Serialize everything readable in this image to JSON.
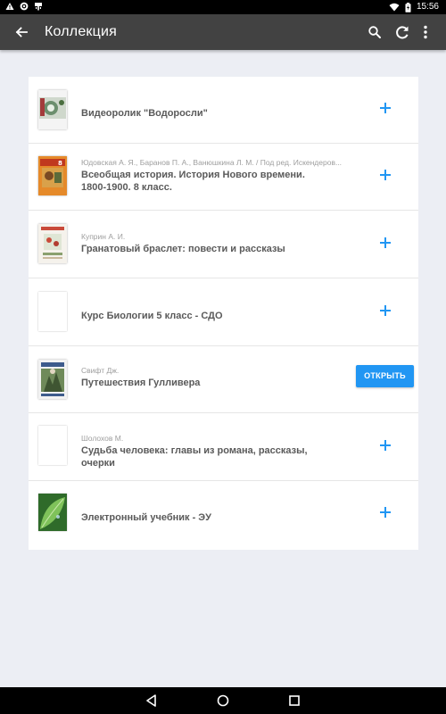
{
  "status_bar": {
    "time": "15:56",
    "left_icons": [
      "warning-icon",
      "settings-icon",
      "usb-icon"
    ],
    "right_icons": [
      "wifi-icon",
      "battery-charging-icon"
    ]
  },
  "toolbar": {
    "title": "Коллекция",
    "back_icon": "arrow-back-icon",
    "actions": [
      "search-icon",
      "refresh-icon",
      "more-vert-icon"
    ]
  },
  "items": [
    {
      "author": "",
      "title": "Видеоролик \"Водоросли\"",
      "action": "add"
    },
    {
      "author": "Юдовская А. Я., Баранов П. А., Ванюшкина Л. М. / Под ред. Искендеров...",
      "title": "Всеобщая история. История Нового времени. 1800-1900. 8 класс.",
      "action": "add"
    },
    {
      "author": "Куприн А. И.",
      "title": "Гранатовый браслет: повести и рассказы",
      "action": "add"
    },
    {
      "author": "",
      "title": "Курс Биологии 5 класс - СДО",
      "action": "add"
    },
    {
      "author": "Свифт Дж.",
      "title": "Путешествия Гулливера",
      "action": "open",
      "action_label": "ОТКРЫТЬ"
    },
    {
      "author": "Шолохов М.",
      "title": "Судьба человека: главы из романа, рассказы, очерки",
      "action": "add"
    },
    {
      "author": "",
      "title": "Электронный учебник - ЭУ",
      "action": "add"
    }
  ],
  "colors": {
    "toolbar": "#424242",
    "accent": "#2196f3",
    "background": "#eceef4"
  },
  "nav_bar": [
    "back-triangle-icon",
    "home-circle-icon",
    "recents-square-icon"
  ]
}
